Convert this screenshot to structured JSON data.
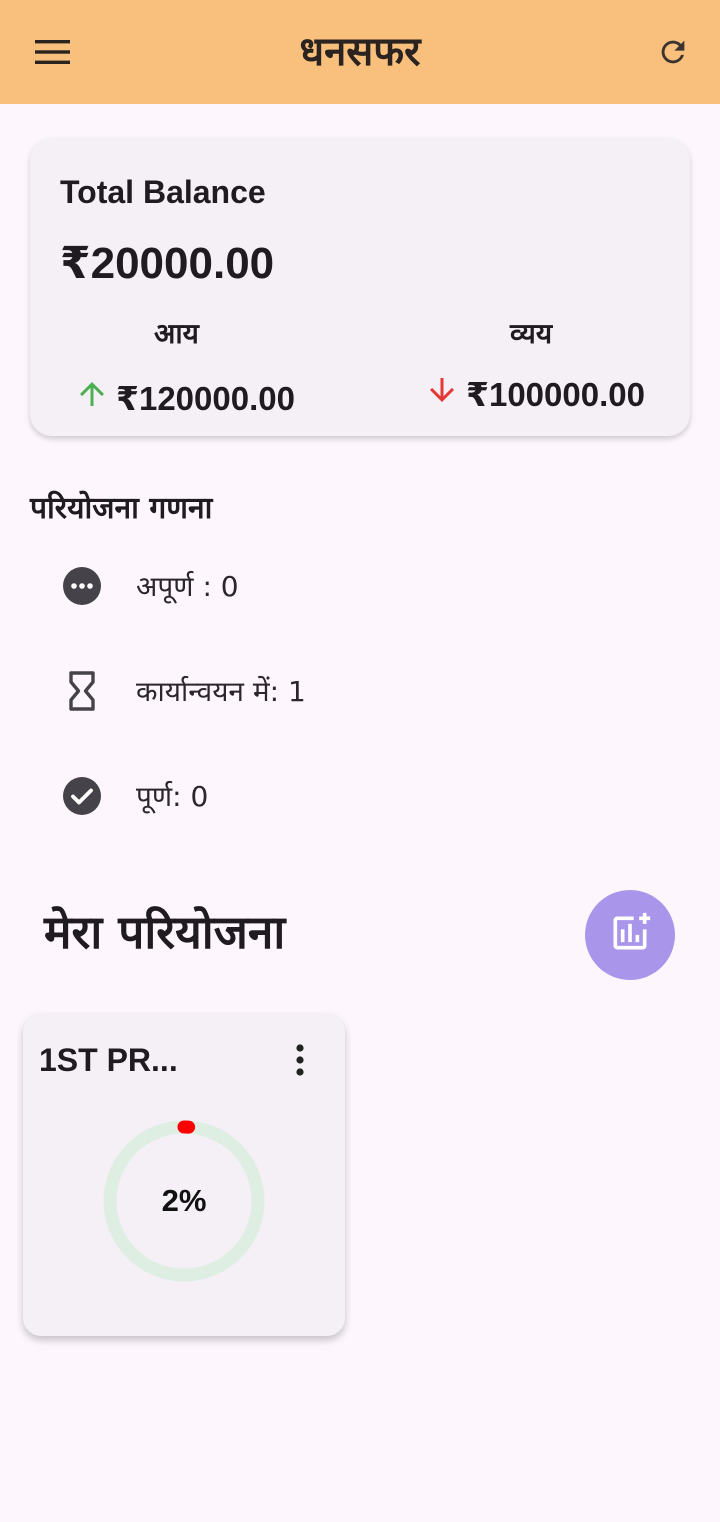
{
  "app": {
    "title": "धनसफर"
  },
  "icons": {
    "menu": "menu-icon",
    "refresh": "refresh-icon"
  },
  "balance": {
    "label": "Total Balance",
    "value": "₹20000.00",
    "income_label": "आय",
    "income_value": "₹120000.00",
    "expense_label": "व्यय",
    "expense_value": "₹100000.00",
    "income_color": "#4caf50",
    "expense_color": "#e53935"
  },
  "project_count": {
    "title": "परियोजना गणना",
    "items": [
      {
        "label": "अपूर्ण : 0",
        "icon": "more-horiz-circle-icon"
      },
      {
        "label": "कार्यान्वयन में: 1",
        "icon": "hourglass-icon"
      },
      {
        "label": "पूर्ण: 0",
        "icon": "check-circle-icon"
      }
    ]
  },
  "my_projects": {
    "title": "मेरा परियोजना",
    "add_icon": "add-chart-icon",
    "fab_color": "#a995ea",
    "cards": [
      {
        "name": "1ST PR...",
        "progress_text": "2%",
        "progress": 0.02,
        "progress_color": "#ff0000",
        "track_color": "#dfeee2"
      }
    ]
  }
}
